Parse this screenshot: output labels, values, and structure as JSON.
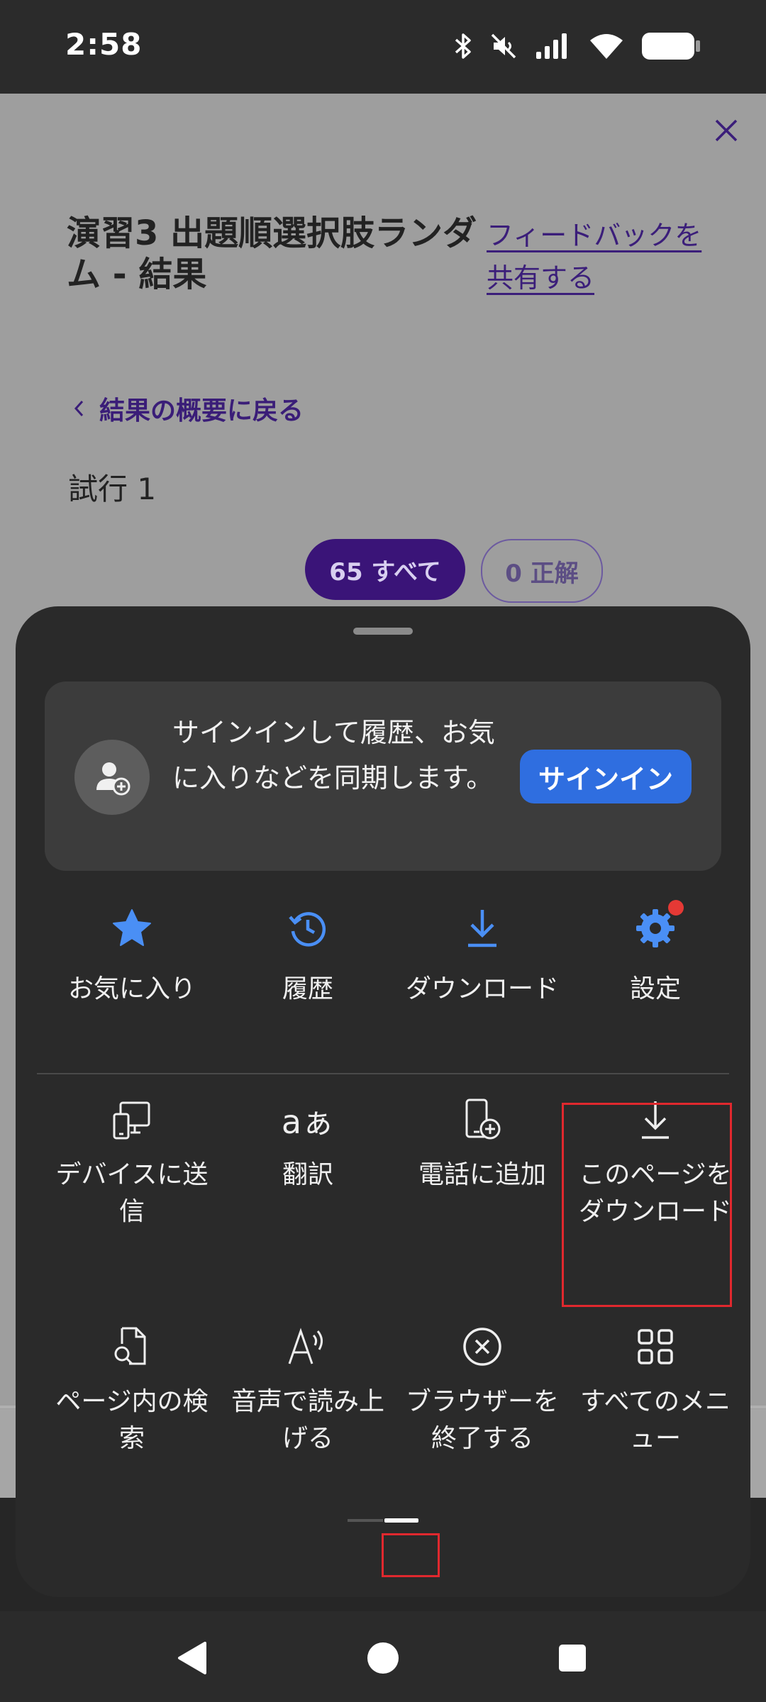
{
  "status_bar": {
    "time": "2:58",
    "icons": [
      "bluetooth-icon",
      "mute-icon",
      "signal-icon",
      "wifi-icon",
      "battery-icon"
    ]
  },
  "webpage": {
    "title": "演習3 出題順選択肢ランダム - 結果",
    "feedback_link": "フィードバックを共有する",
    "back_link": "結果の概要に戻る",
    "attempt": "試行 1",
    "filter_all": "65 すべて",
    "filter_correct": "0 正解"
  },
  "menu_sheet": {
    "signin_message": "サインインして履歴、お気に入りなどを同期します。",
    "signin_button": "サインイン",
    "top_row": [
      {
        "label": "お気に入り",
        "icon": "star-icon"
      },
      {
        "label": "履歴",
        "icon": "history-icon"
      },
      {
        "label": "ダウンロード",
        "icon": "download-icon"
      },
      {
        "label": "設定",
        "icon": "gear-icon"
      }
    ],
    "middle_row": [
      {
        "label": "デバイスに送信",
        "icon": "send-to-device-icon"
      },
      {
        "label": "翻訳",
        "icon": "translate-icon"
      },
      {
        "label": "電話に追加",
        "icon": "add-to-phone-icon"
      },
      {
        "label": "このページをダウンロード",
        "icon": "download-page-icon"
      }
    ],
    "bottom_row": [
      {
        "label": "ページ内の検索",
        "icon": "find-in-page-icon"
      },
      {
        "label": "音声で読み上げる",
        "icon": "read-aloud-icon"
      },
      {
        "label": "ブラウザーを終了する",
        "icon": "exit-browser-icon"
      },
      {
        "label": "すべてのメニュー",
        "icon": "all-menu-icon"
      }
    ],
    "colors": {
      "accent_blue": "#4a8ff5",
      "badge_red": "#e53935",
      "highlight_red": "#e0282e",
      "signin_button": "#2f6ee0"
    }
  }
}
